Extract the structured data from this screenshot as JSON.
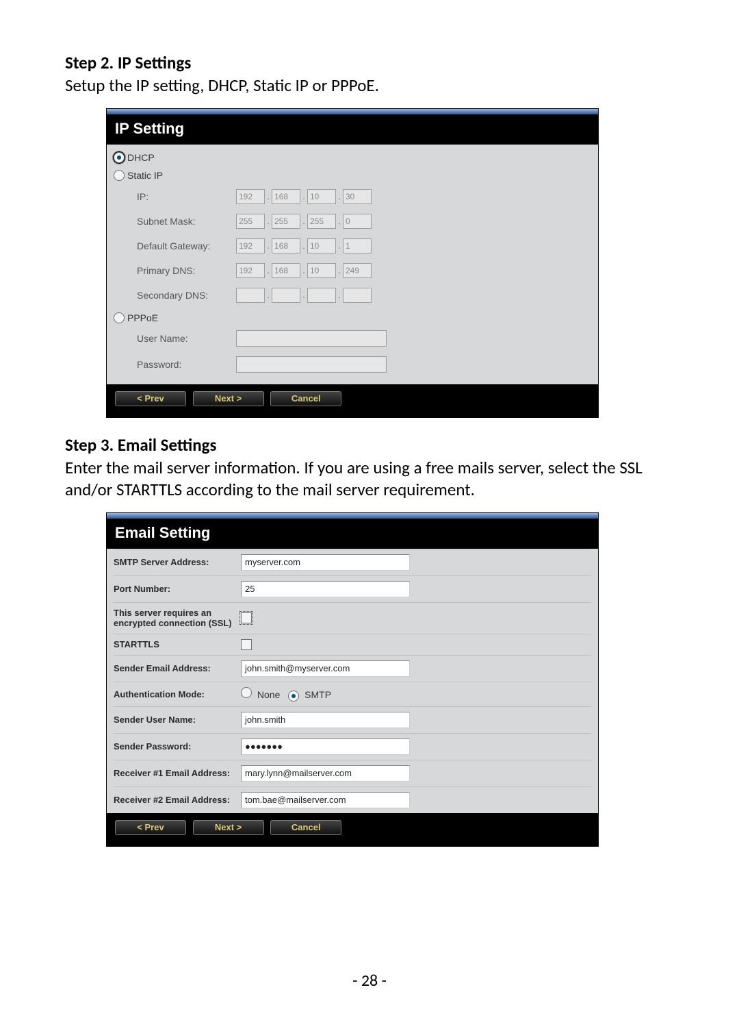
{
  "step2": {
    "heading": "Step 2. IP Settings",
    "desc": "Setup the IP setting, DHCP, Static IP or PPPoE."
  },
  "ip_panel": {
    "title": "IP Setting",
    "radios": {
      "dhcp": "DHCP",
      "static": "Static IP",
      "pppoe": "PPPoE"
    },
    "fields": {
      "ip_label": "IP:",
      "subnet_label": "Subnet Mask:",
      "gateway_label": "Default Gateway:",
      "pdns_label": "Primary DNS:",
      "sdns_label": "Secondary DNS:",
      "username_label": "User Name:",
      "password_label": "Password:",
      "ip": [
        "192",
        "168",
        "10",
        "30"
      ],
      "subnet": [
        "255",
        "255",
        "255",
        "0"
      ],
      "gateway": [
        "192",
        "168",
        "10",
        "1"
      ],
      "pdns": [
        "192",
        "168",
        "10",
        "249"
      ],
      "sdns": [
        "",
        "",
        "",
        ""
      ],
      "username": "",
      "password": ""
    },
    "buttons": {
      "prev": "< Prev",
      "next": "Next >",
      "cancel": "Cancel"
    }
  },
  "step3": {
    "heading": "Step 3. Email Settings",
    "desc": "Enter the mail server information. If you are using a free mails server, select the SSL and/or STARTTLS according to the mail server requirement."
  },
  "email_panel": {
    "title": "Email Setting",
    "rows": {
      "smtp_label": "SMTP Server Address:",
      "smtp": "myserver.com",
      "port_label": "Port Number:",
      "port": "25",
      "ssl_label": "This server requires an encrypted connection (SSL)",
      "starttls_label": "STARTTLS",
      "sender_label": "Sender Email Address:",
      "sender": "john.smith@myserver.com",
      "auth_label": "Authentication Mode:",
      "auth_none": "None",
      "auth_smtp": "SMTP",
      "user_label": "Sender User Name:",
      "user": "john.smith",
      "pwd_label": "Sender Password:",
      "pwd": "●●●●●●●",
      "rcv1_label": "Receiver #1 Email Address:",
      "rcv1": "mary.lynn@mailserver.com",
      "rcv2_label": "Receiver #2 Email Address:",
      "rcv2": "tom.bae@mailserver.com"
    },
    "buttons": {
      "prev": "< Prev",
      "next": "Next >",
      "cancel": "Cancel"
    }
  },
  "page_number": "- 28 -"
}
